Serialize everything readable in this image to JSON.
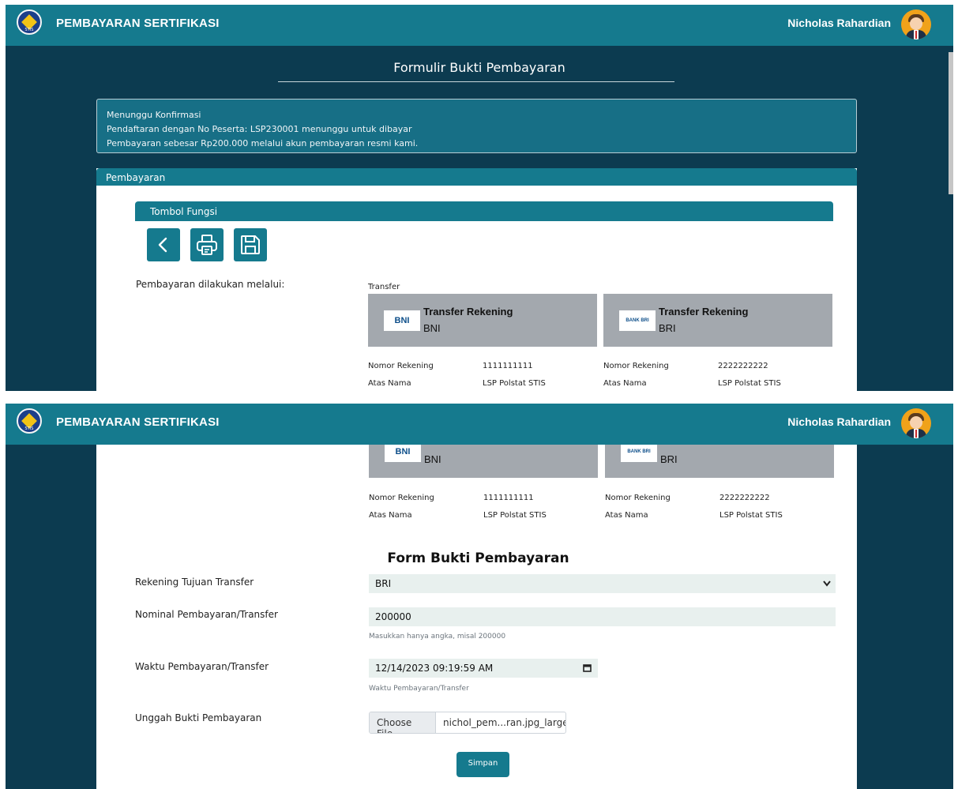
{
  "app": {
    "title": "PEMBAYARAN SERTIFIKASI",
    "user_name": "Nicholas Rahardian",
    "logo_text": "STIS"
  },
  "page": {
    "title": "Formulir Bukti Pembayaran"
  },
  "alert": {
    "lines": [
      "Menunggu Konfirmasi",
      "Pendaftaran dengan No Peserta: LSP230001 menunggu untuk dibayar",
      "Pembayaran sebesar Rp200.000 melalui akun pembayaran resmi kami."
    ]
  },
  "payment_card": {
    "header": "Pembayaran",
    "function_header": "Tombol Fungsi",
    "method_label": "Pembayaran dilakukan melalui:",
    "transfer_label": "Transfer"
  },
  "banks": [
    {
      "title": "Transfer Rekening",
      "name": "BNI",
      "logo": "BNI",
      "account_label": "Nomor Rekening",
      "account_number": "1111111111",
      "holder_label": "Atas Nama",
      "holder": "LSP Polstat STIS"
    },
    {
      "title": "Transfer Rekening",
      "name": "BRI",
      "logo": "BANK BRI",
      "account_label": "Nomor Rekening",
      "account_number": "2222222222",
      "holder_label": "Atas Nama",
      "holder": "LSP Polstat STIS"
    }
  ],
  "form": {
    "title": "Form Bukti Pembayaran",
    "rekening_label": "Rekening Tujuan Transfer",
    "rekening_value": "BRI",
    "nominal_label": "Nominal Pembayaran/Transfer",
    "nominal_value": "200000",
    "nominal_help": "Masukkan hanya angka, misal 200000",
    "waktu_label": "Waktu Pembayaran/Transfer",
    "waktu_value": "12/14/2023 09:19:59 AM",
    "waktu_help": "Waktu Pembayaran/Transfer",
    "upload_label": "Unggah Bukti Pembayaran",
    "upload_button": "Choose File",
    "upload_filename": "nichol_pem...ran.jpg_large",
    "submit_label": "Simpan"
  },
  "colors": {
    "header_bg": "#157a8e",
    "page_bg": "#0c3b50",
    "bank_card_bg": "#a3a8ae",
    "input_bg": "#e8f0ee"
  }
}
